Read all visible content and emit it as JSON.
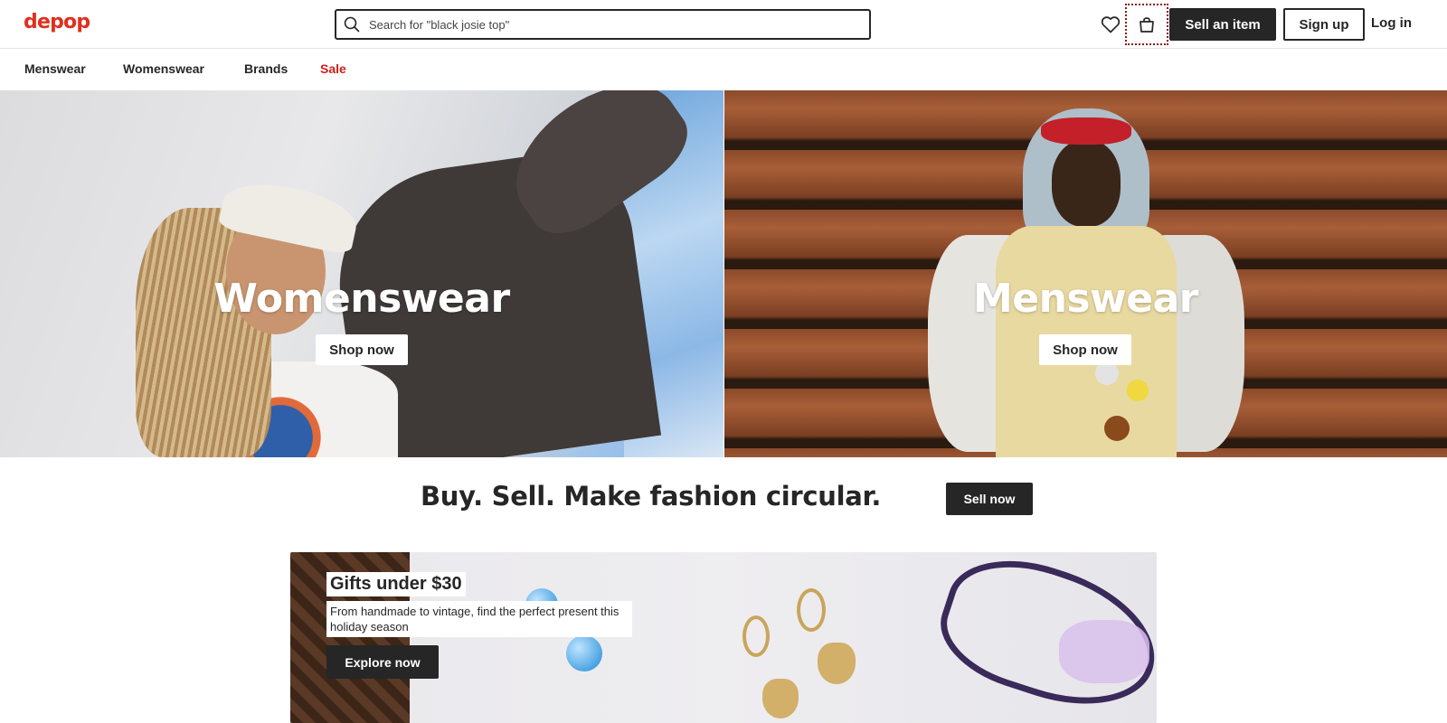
{
  "header": {
    "logo": "depop",
    "search_placeholder": "Search for \"black josie top\"",
    "sell_item_label": "Sell an item",
    "signup_label": "Sign up",
    "login_label": "Log in",
    "icons": [
      "search-icon",
      "heart-icon",
      "bag-icon"
    ]
  },
  "nav": {
    "items": [
      {
        "label": "Menswear"
      },
      {
        "label": "Womenswear"
      },
      {
        "label": "Brands"
      },
      {
        "label": "Sale"
      }
    ]
  },
  "hero": {
    "left": {
      "title": "Womenswear",
      "cta": "Shop now"
    },
    "right": {
      "title": "Menswear",
      "cta": "Shop now"
    }
  },
  "tagline": {
    "text": "Buy. Sell. Make fashion circular.",
    "cta": "Sell now"
  },
  "promo": {
    "title": "Gifts under $30",
    "subtitle": "From handmade to vintage, find the perfect present this holiday season",
    "cta": "Explore now"
  },
  "colors": {
    "brand": "#e0301e",
    "sale": "#d0201a",
    "dark": "#262626"
  }
}
